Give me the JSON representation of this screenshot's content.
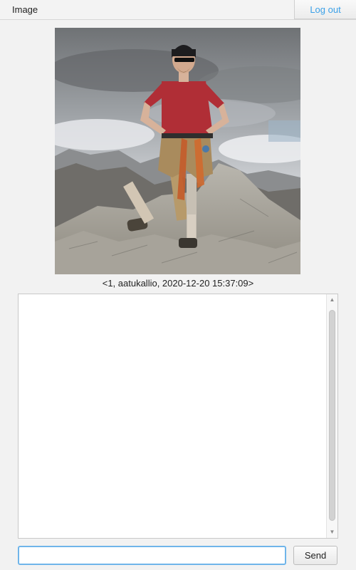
{
  "header": {
    "title": "Image",
    "logout_label": "Log out"
  },
  "image": {
    "caption": "<1, aatukallio, 2020-12-20 15:37:09>"
  },
  "chat": {
    "messages": []
  },
  "composer": {
    "input_value": "",
    "send_label": "Send"
  },
  "colors": {
    "accent": "#3aa0e8",
    "input_focus_border": "#6fb5ea"
  }
}
